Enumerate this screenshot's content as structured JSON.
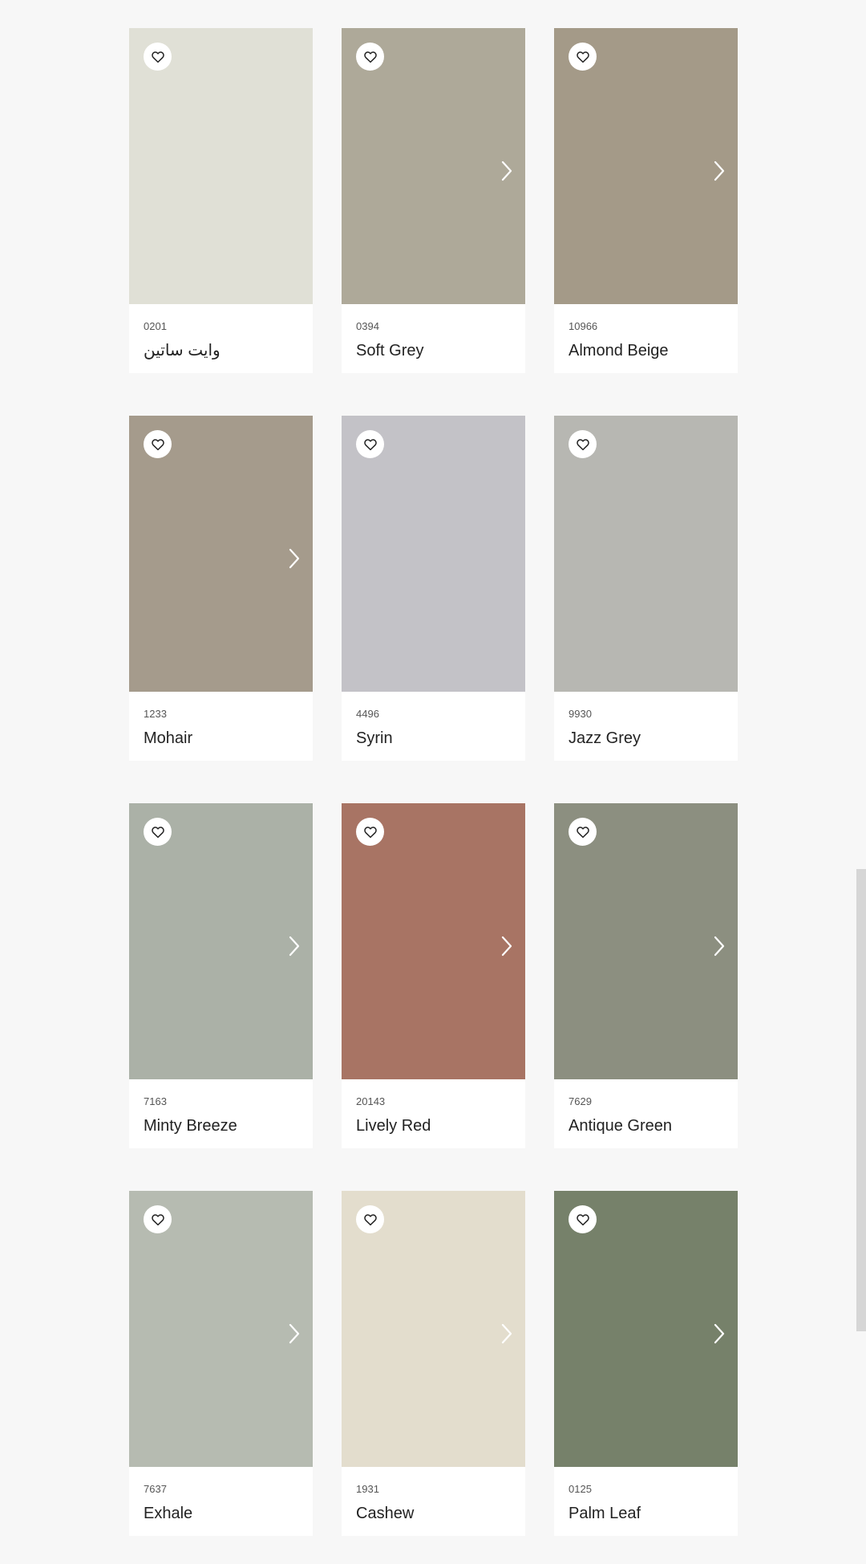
{
  "colors": [
    {
      "code": "0201",
      "name": "وايت ساتين",
      "hex": "#e0e0d6",
      "has_chevron": false
    },
    {
      "code": "0394",
      "name": "Soft Grey",
      "hex": "#aea999",
      "has_chevron": true
    },
    {
      "code": "10966",
      "name": "Almond Beige",
      "hex": "#a49a88",
      "has_chevron": true
    },
    {
      "code": "1233",
      "name": "Mohair",
      "hex": "#a59b8c",
      "has_chevron": true
    },
    {
      "code": "4496",
      "name": "Syrin",
      "hex": "#c3c2c7",
      "has_chevron": false
    },
    {
      "code": "9930",
      "name": "Jazz Grey",
      "hex": "#b7b7b2",
      "has_chevron": false
    },
    {
      "code": "7163",
      "name": "Minty Breeze",
      "hex": "#abb1a7",
      "has_chevron": true
    },
    {
      "code": "20143",
      "name": "Lively Red",
      "hex": "#a87464",
      "has_chevron": true
    },
    {
      "code": "7629",
      "name": "Antique Green",
      "hex": "#8c8f80",
      "has_chevron": true
    },
    {
      "code": "7637",
      "name": "Exhale",
      "hex": "#b6bbb1",
      "has_chevron": true
    },
    {
      "code": "1931",
      "name": "Cashew",
      "hex": "#e3ddcd",
      "has_chevron": true
    },
    {
      "code": "0125",
      "name": "Palm Leaf",
      "hex": "#76816a",
      "has_chevron": true
    }
  ],
  "icons": {
    "favorite": "heart-icon",
    "next": "chevron-right-icon"
  }
}
